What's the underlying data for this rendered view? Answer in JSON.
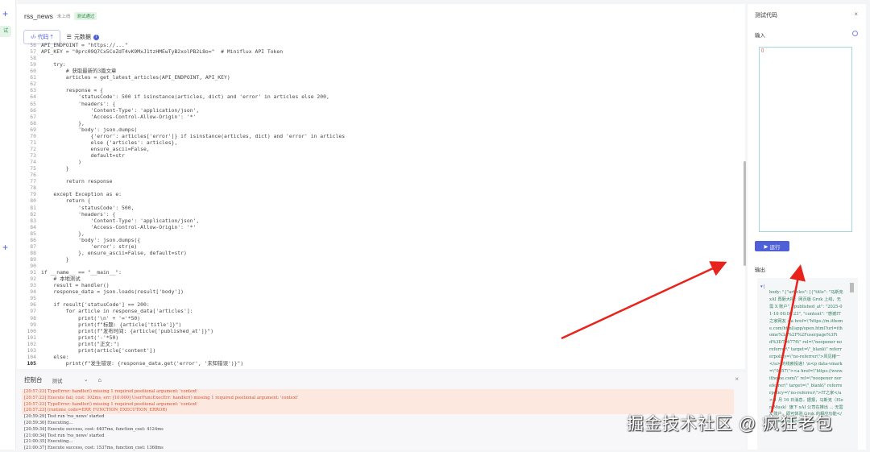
{
  "sidebar": {
    "tag": "试"
  },
  "header": {
    "name": "rss_news",
    "status": "未上线",
    "badge": "测试通过"
  },
  "tabs": [
    {
      "label": "代码"
    },
    {
      "label": "元数据",
      "badge": "i"
    }
  ],
  "code": [
    {
      "n": "56",
      "t": "API_ENDPOINT = \"https://...\""
    },
    {
      "n": "57",
      "t": "API_KEY = \"0prc09Q7Cx5CoZdT4vK9MxJ1tzHMEwTyB2xolPB2L8o=\"  # Miniflux API Token"
    },
    {
      "n": "58",
      "t": ""
    },
    {
      "n": "59",
      "t": "    try:"
    },
    {
      "n": "60",
      "t": "        # 获取最新的3篇文章"
    },
    {
      "n": "61",
      "t": "        articles = get_latest_articles(API_ENDPOINT, API_KEY)"
    },
    {
      "n": "62",
      "t": ""
    },
    {
      "n": "63",
      "t": "        response = {"
    },
    {
      "n": "64",
      "t": "            'statusCode': 500 if isinstance(articles, dict) and 'error' in articles else 200,"
    },
    {
      "n": "65",
      "t": "            'headers': {"
    },
    {
      "n": "66",
      "t": "                'Content-Type': 'application/json',"
    },
    {
      "n": "67",
      "t": "                'Access-Control-Allow-Origin': '*'"
    },
    {
      "n": "68",
      "t": "            },"
    },
    {
      "n": "69",
      "t": "            'body': json.dumps("
    },
    {
      "n": "70",
      "t": "                {'error': articles['error']} if isinstance(articles, dict) and 'error' in articles"
    },
    {
      "n": "71",
      "t": "                else {'articles': articles},"
    },
    {
      "n": "72",
      "t": "                ensure_ascii=False,"
    },
    {
      "n": "73",
      "t": "                default=str"
    },
    {
      "n": "74",
      "t": "            )"
    },
    {
      "n": "75",
      "t": "        }"
    },
    {
      "n": "76",
      "t": ""
    },
    {
      "n": "77",
      "t": "        return response"
    },
    {
      "n": "78",
      "t": ""
    },
    {
      "n": "79",
      "t": "    except Exception as e:"
    },
    {
      "n": "80",
      "t": "        return {"
    },
    {
      "n": "81",
      "t": "            'statusCode': 500,"
    },
    {
      "n": "82",
      "t": "            'headers': {"
    },
    {
      "n": "83",
      "t": "                'Content-Type': 'application/json',"
    },
    {
      "n": "84",
      "t": "                'Access-Control-Allow-Origin': '*'"
    },
    {
      "n": "85",
      "t": "            },"
    },
    {
      "n": "86",
      "t": "            'body': json.dumps({"
    },
    {
      "n": "87",
      "t": "                'error': str(e)"
    },
    {
      "n": "88",
      "t": "            }, ensure_ascii=False, default=str)"
    },
    {
      "n": "89",
      "t": "        }"
    },
    {
      "n": "90",
      "t": ""
    },
    {
      "n": "91",
      "t": "if __name__ == \"__main__\":"
    },
    {
      "n": "92",
      "t": "    # 本地测试"
    },
    {
      "n": "93",
      "t": "    result = handler()"
    },
    {
      "n": "94",
      "t": "    response_data = json.loads(result['body'])"
    },
    {
      "n": "95",
      "t": ""
    },
    {
      "n": "96",
      "t": "    if result['statusCode'] == 200:"
    },
    {
      "n": "97",
      "t": "        for article in response_data['articles']:"
    },
    {
      "n": "98",
      "t": "            print('\\n' + '='*50)"
    },
    {
      "n": "99",
      "t": "            print(f\"标题: {article['title']}\")"
    },
    {
      "n": "100",
      "t": "            print(f\"发布时间: {article['published_at']}\")"
    },
    {
      "n": "101",
      "t": "            print('-'*50)"
    },
    {
      "n": "102",
      "t": "            print(\"正文:\")"
    },
    {
      "n": "103",
      "t": "            print(article['content'])"
    },
    {
      "n": "104",
      "t": "    else:"
    },
    {
      "n": "105",
      "t": "        print(f\"发生错误: {response_data.get('error', '未知错误')}\")"
    }
  ],
  "console": {
    "title": "控制台",
    "env": "测试",
    "logs": [
      {
        "t": "[20:57:23] TypeError: handler() missing 1 required positional argument: 'context'",
        "err": true
      },
      {
        "t": "[20:57:23] Execute fail, cost: 102ms, err: [10:000] UserFuncExecErr: handler() missing 1 required positional argument: 'context'",
        "err": true
      },
      {
        "t": "[20:57:23] TypeError: handler() missing 1 required positional argument: 'context'",
        "err": true
      },
      {
        "t": "[20:57:23] (runtime_code=ERR_FUNCTION_EXECUTION_ERROR)",
        "err": true
      },
      {
        "t": "[20:59:29] Test run 'rss_news' started",
        "err": false
      },
      {
        "t": "[20:59:30] Executing...",
        "err": false
      },
      {
        "t": "[20:59:34] Execute success, cost: 4407ms, function_cost: 4124ms",
        "err": false
      },
      {
        "t": "[21:00:34] Test run 'rss_news' started",
        "err": false
      },
      {
        "t": "[21:00:35] Executing...",
        "err": false
      },
      {
        "t": "[21:00:37] Execute success, cost: 1537ms, function_cost: 1368ms",
        "err": false
      }
    ]
  },
  "right": {
    "title": "测试代码",
    "input_label": "输入",
    "input_value": "{}",
    "run_label": "运行",
    "output_label": "输出",
    "output_text": "body: \"{\"articles\": [{\"title\": \"马斯克 xAI 再砸大招：网页版 Grok 上线，无需 X 账户\", \"published_at\": \"2025-01-16 00:06:23\", \"content\": \"感谢IT之家网友 <a href=\\\"https://m.ithome.com/html/app/open.html?url=ithome%3A%2F%2Fuserpage%3Fid%3D796776\\\" rel=\\\"noopener noreferrer\\\" target=\\\"_blank\\\" referrerpolicy=\\\"no-referrer\\\">风见椿一</a> 的线索投递！\\n<p data-vmark=\\\"9057\\\"><a href=\\\"https://www.ithome.com/\\\" rel=\\\"noopener noreferrer\\\" target=\\\"_blank\\\" referrerpolicy=\\\"no-referrer\\\">IT之家</a> 1 月 16 日消息，据报，马斯克（Elon Musk）旗下 xAI 公司在推出 ... 无需 X 账户，即可体验 Grok 的相应功能</strong></p><p data-"
  },
  "watermark": "掘金技术社区 @ 疯狂老包"
}
